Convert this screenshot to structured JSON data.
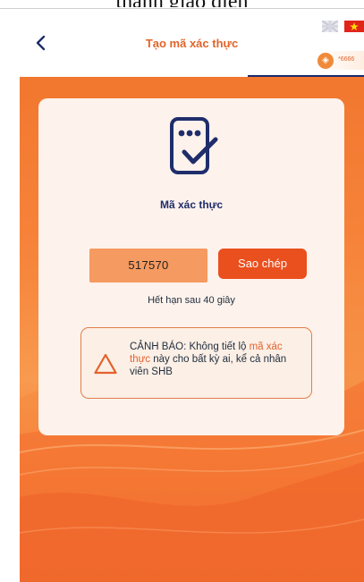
{
  "caption": "thanh giao diện",
  "header": {
    "title": "Tạo mã xác thực",
    "back_icon": "chevron-left-icon",
    "pill_text": "*6666",
    "flags": [
      "uk-flag-icon",
      "vietnam-flag-icon"
    ]
  },
  "card": {
    "label": "Mã xác thực",
    "otp_code": "517570",
    "copy_button": "Sao chép",
    "expiry_text": "Hết hạn sau 40 giây",
    "warning": {
      "prefix": "CẢNH BÁO: Không tiết lộ ",
      "highlight": "mã xác thực",
      "suffix": " này cho bất kỳ ai, kể cả nhân viên SHB"
    }
  },
  "colors": {
    "accent": "#e0642a",
    "navy": "#1f2d6b",
    "button": "#ea4f1e",
    "background": "#f6843a"
  }
}
